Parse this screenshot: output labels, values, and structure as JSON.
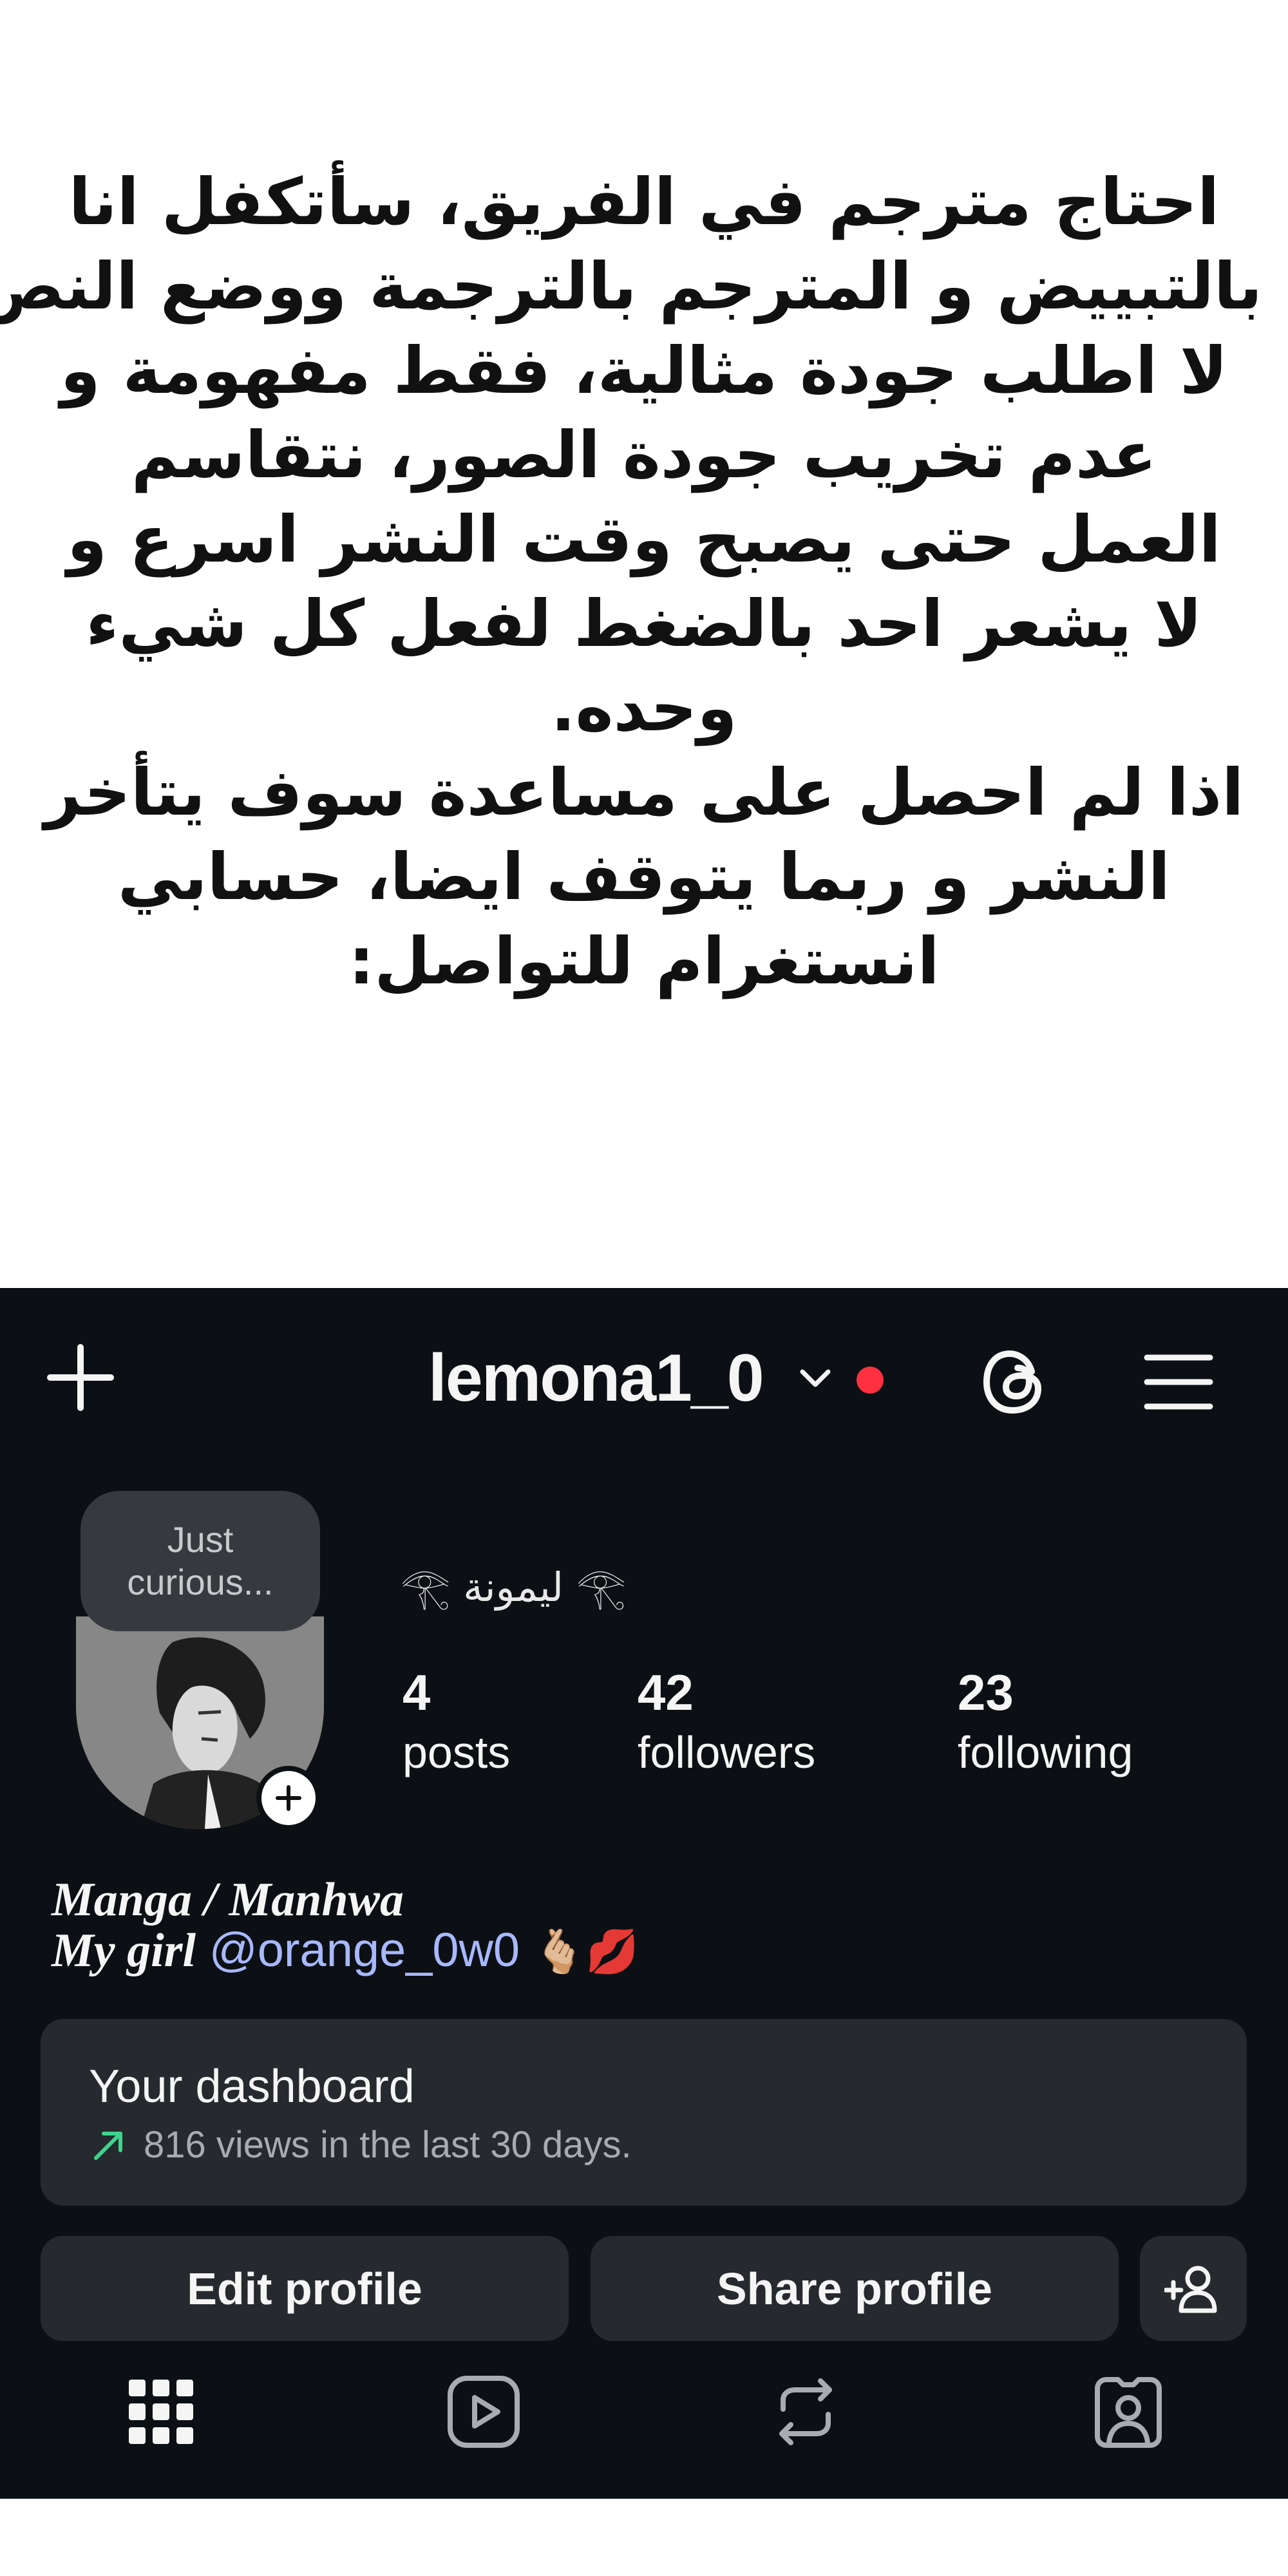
{
  "announcement": {
    "lines": [
      "احتاج مترجم في الفريق، سأتكفل انا",
      "بالتبييض و المترجم بالترجمة ووضع النص،",
      "لا اطلب جودة مثالية، فقط مفهومة و",
      "عدم تخريب جودة الصور، نتقاسم",
      "العمل حتى يصبح وقت النشر اسرع و",
      "لا يشعر احد بالضغط لفعل كل شيء",
      "وحده.",
      "اذا لم احصل على مساعدة سوف يتأخر",
      "النشر و ربما يتوقف ايضا، حسابي",
      "انستغرام للتواصل:"
    ]
  },
  "profile": {
    "header": {
      "username": "lemona1_0",
      "icons": [
        "add-icon",
        "chevron-down-icon",
        "notification-dot",
        "threads-icon",
        "menu-icon"
      ]
    },
    "note": {
      "line1": "Just",
      "line2": "curious..."
    },
    "display_name": "𓂀 ليمونة 𓂀",
    "display_name_decor": "𓆸",
    "stats": {
      "posts": {
        "count": "4",
        "label": "posts"
      },
      "followers": {
        "count": "42",
        "label": "followers"
      },
      "following": {
        "count": "23",
        "label": "following"
      }
    },
    "bio": {
      "line1": "Manga / Manhwa",
      "line2_prefix": "My girl",
      "mention": "@orange_0w0",
      "emojis": "🫰🏼💋"
    },
    "dashboard": {
      "title": "Your dashboard",
      "subtitle": "816 views in the last 30 days."
    },
    "buttons": {
      "edit": "Edit profile",
      "share": "Share profile"
    },
    "tabs": [
      "grid-icon",
      "reels-icon",
      "reposts-icon",
      "tagged-icon"
    ],
    "colors": {
      "background": "#0c1014",
      "card": "#26292e",
      "mention": "#a8b8ff",
      "notification": "#ff3040",
      "trend": "#3dd68c"
    }
  }
}
